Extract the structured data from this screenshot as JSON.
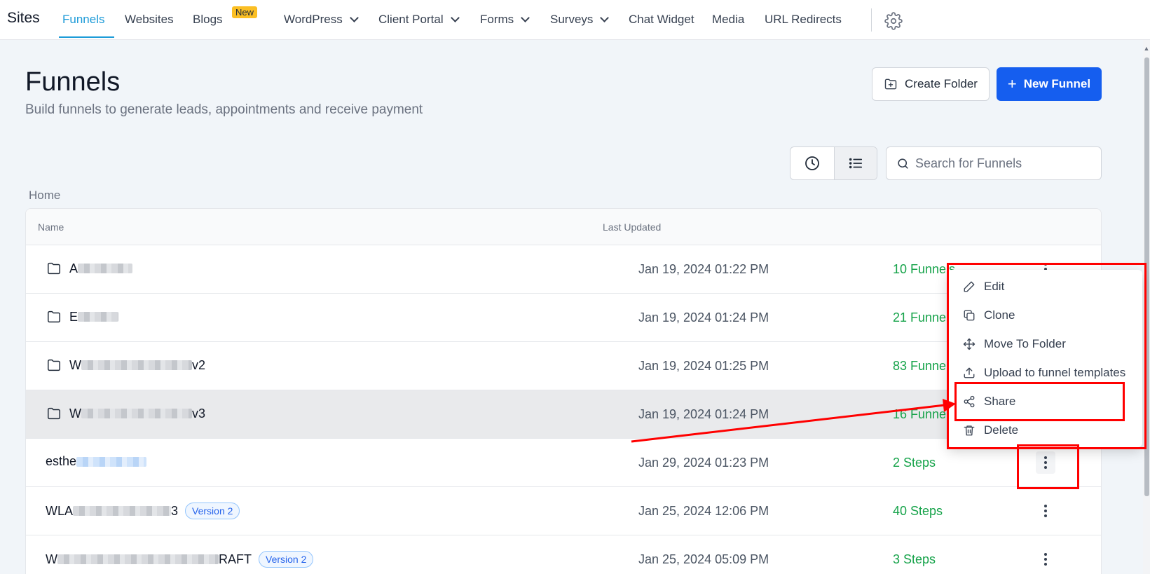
{
  "nav": {
    "brand": "Sites",
    "items": [
      {
        "label": "Funnels"
      },
      {
        "label": "Websites"
      },
      {
        "label": "Blogs"
      },
      {
        "label": "WordPress"
      },
      {
        "label": "Client Portal"
      },
      {
        "label": "Forms"
      },
      {
        "label": "Surveys"
      },
      {
        "label": "Chat Widget"
      },
      {
        "label": "Media"
      },
      {
        "label": "URL Redirects"
      }
    ],
    "new_badge": "New",
    "settings_icon": "gear-icon"
  },
  "header": {
    "title": "Funnels",
    "subtitle": "Build funnels to generate leads, appointments and receive payment",
    "create_folder_label": "Create Folder",
    "new_funnel_label": "New Funnel"
  },
  "search": {
    "placeholder": "Search for Funnels"
  },
  "breadcrumb": "Home",
  "table": {
    "columns": [
      "Name",
      "Last Updated"
    ],
    "rows": [
      {
        "name": "A",
        "date": "Jan 19, 2024 01:22 PM",
        "count": "10 Funnels"
      },
      {
        "name": "E",
        "date": "Jan 19, 2024 01:24 PM",
        "count": "21 Funnels"
      },
      {
        "name": "W",
        "suffix": "v2",
        "date": "Jan 19, 2024 01:25 PM",
        "count": "83 Funnels"
      },
      {
        "name": "W",
        "suffix": "v3",
        "date": "Jan 19, 2024 01:24 PM",
        "count": "16 Funnels"
      },
      {
        "name": "esthe",
        "date": "Jan 29, 2024 01:23 PM",
        "count": "2 Steps"
      },
      {
        "name": "WLA",
        "suffix": "3",
        "badge": "Version 2",
        "date": "Jan 25, 2024 12:06 PM",
        "count": "40 Steps"
      },
      {
        "name": "W",
        "suffix": "RAFT",
        "badge": "Version 2",
        "date": "Jan 25, 2024 05:09 PM",
        "count": "3 Steps"
      }
    ]
  },
  "menu": {
    "items": [
      {
        "label": "Edit",
        "icon": "pencil-icon"
      },
      {
        "label": "Clone",
        "icon": "copy-icon"
      },
      {
        "label": "Move To Folder",
        "icon": "move-icon"
      },
      {
        "label": "Upload to funnel templates",
        "icon": "upload-icon"
      },
      {
        "label": "Share",
        "icon": "share-icon"
      },
      {
        "label": "Delete",
        "icon": "trash-icon"
      }
    ]
  },
  "colors": {
    "accent": "#1d9bd8",
    "primary_button": "#155eef",
    "success": "#16a34a",
    "annotation": "#ff0000",
    "badge": "#fbbf24"
  }
}
